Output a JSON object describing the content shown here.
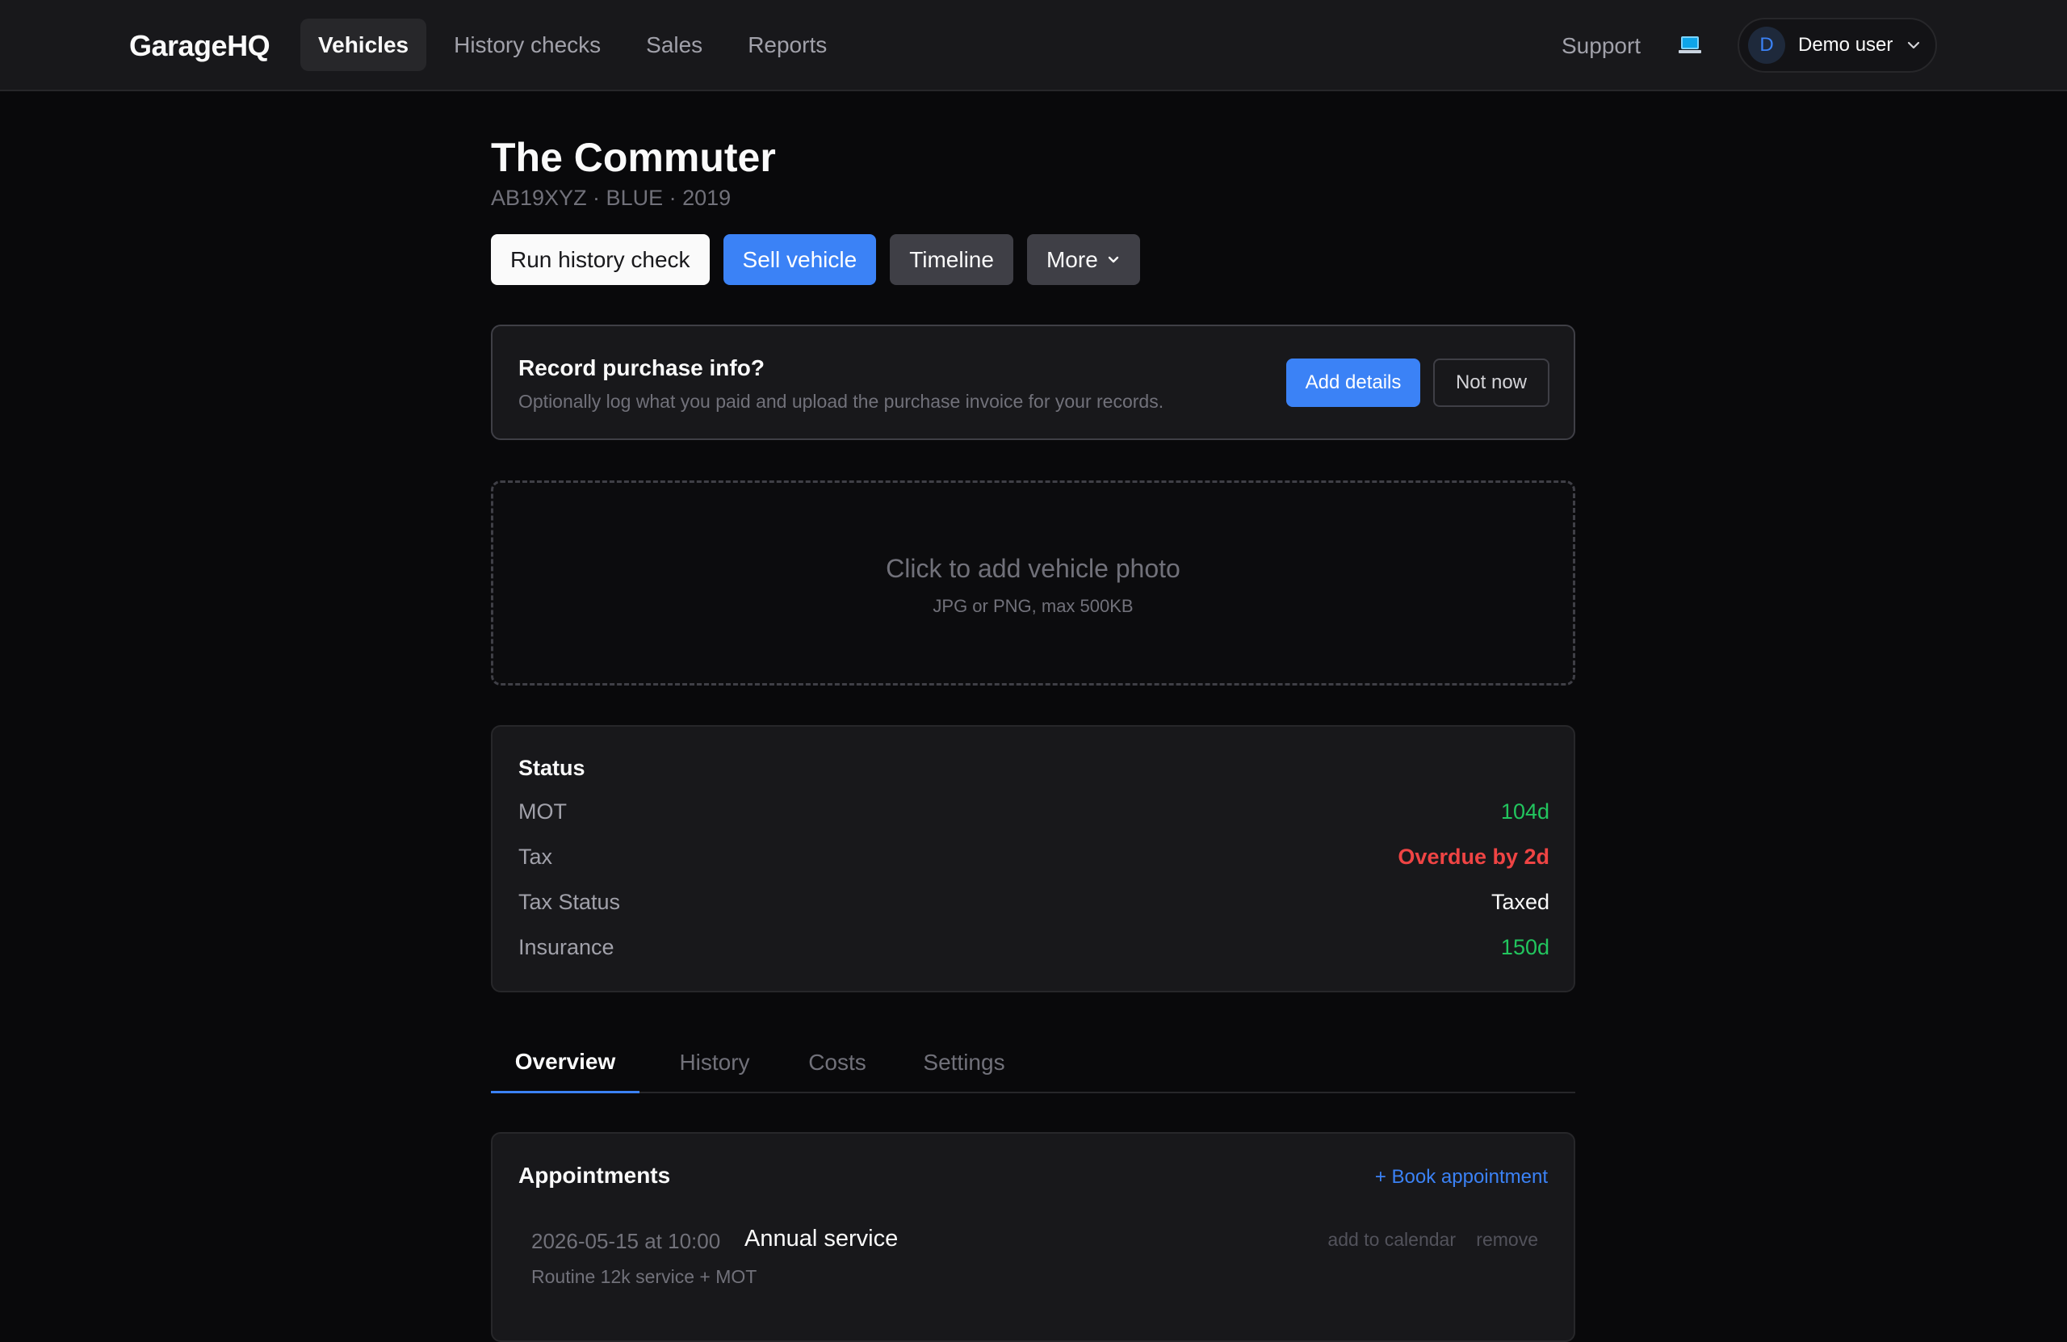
{
  "nav": {
    "brand": "GarageHQ",
    "items": [
      {
        "label": "Vehicles",
        "active": true
      },
      {
        "label": "History checks",
        "active": false
      },
      {
        "label": "Sales",
        "active": false
      },
      {
        "label": "Reports",
        "active": false
      }
    ],
    "support": "Support",
    "device_icon": "laptop-icon",
    "user": {
      "initial": "D",
      "name": "Demo user"
    }
  },
  "vehicle": {
    "title": "The Commuter",
    "subtitle": "AB19XYZ · BLUE · 2019"
  },
  "actions": {
    "history_check": "Run history check",
    "sell": "Sell vehicle",
    "timeline": "Timeline",
    "more": "More"
  },
  "purchase": {
    "title": "Record purchase info?",
    "description": "Optionally log what you paid and upload the purchase invoice for your records.",
    "add_label": "Add details",
    "dismiss_label": "Not now"
  },
  "photo": {
    "prompt": "Click to add vehicle photo",
    "hint": "JPG or PNG, max 500KB"
  },
  "status": {
    "title": "Status",
    "rows": [
      {
        "label": "MOT",
        "value": "104d",
        "tone": "green"
      },
      {
        "label": "Tax",
        "value": "Overdue by 2d",
        "tone": "red"
      },
      {
        "label": "Tax Status",
        "value": "Taxed",
        "tone": "white"
      },
      {
        "label": "Insurance",
        "value": "150d",
        "tone": "green"
      }
    ]
  },
  "tabs": [
    {
      "label": "Overview",
      "active": true
    },
    {
      "label": "History",
      "active": false
    },
    {
      "label": "Costs",
      "active": false
    },
    {
      "label": "Settings",
      "active": false
    }
  ],
  "appointments": {
    "title": "Appointments",
    "book_label": "+ Book appointment",
    "items": [
      {
        "datetime": "2026-05-15 at 10:00",
        "name": "Annual service",
        "note": "Routine 12k service + MOT",
        "calendar_label": "add to calendar",
        "remove_label": "remove"
      }
    ]
  },
  "colors": {
    "accent": "#3b82f6",
    "ok": "#22c55e",
    "danger": "#ef4444",
    "background": "#09090b",
    "surface": "#18181b"
  }
}
